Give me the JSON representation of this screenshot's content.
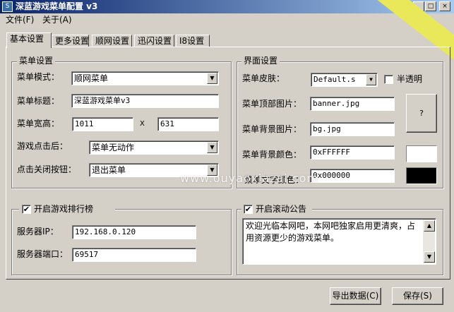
{
  "window": {
    "title": "深蓝游戏菜单配置 v3",
    "icon_label": "S",
    "minimize_glyph": "_",
    "maximize_glyph": "□",
    "close_glyph": "×"
  },
  "menu": [
    "文件(F)",
    "关于(A)"
  ],
  "tabs": [
    {
      "label": "基本设置",
      "active": true
    },
    {
      "label": "更多设置",
      "active": false
    },
    {
      "label": "顺网设置",
      "active": false
    },
    {
      "label": "迅闪设置",
      "active": false
    },
    {
      "label": "I8设置",
      "active": false
    }
  ],
  "menu_settings": {
    "group_title": "菜单设置",
    "mode_label": "菜单模式：",
    "mode_value": "顺网菜单",
    "title_label": "菜单标题：",
    "title_value": "深蓝游戏菜单v3",
    "size_label": "菜单宽高：",
    "width_value": "1011",
    "x_sep": "X",
    "height_value": "631",
    "after_click_label": "游戏点击后：",
    "after_click_value": "菜单无动作",
    "close_button_label": "点击关闭按钮：",
    "close_button_value": "退出菜单"
  },
  "ui_settings": {
    "group_title": "界面设置",
    "skin_label": "菜单皮肤：",
    "skin_value": "Default.s",
    "translucent_label": "半透明",
    "translucent_checked": false,
    "banner_label": "菜单顶部图片：",
    "banner_value": "banner.jpg",
    "bg_label": "菜单背景图片：",
    "bg_value": "bg.jpg",
    "bgcolor_label": "菜单背景颜色：",
    "bgcolor_value": "0xFFFFFF",
    "bgcolor_swatch": "#FFFFFF",
    "textcolor_label": "菜单文字颜色：",
    "textcolor_value": "0x000000",
    "textcolor_swatch": "#000000",
    "help_button": "?"
  },
  "ranking": {
    "checkbox_label": "开启游戏排行榜",
    "checked": true,
    "server_ip_label": "服务器IP：",
    "server_ip_value": "192.168.0.120",
    "server_port_label": "服务器端口：",
    "server_port_value": "69517"
  },
  "notice": {
    "checkbox_label": "开启滚动公告",
    "checked": true,
    "text": "欢迎光临本网吧，本网吧独家启用更清爽，占用资源更少的游戏菜单。"
  },
  "buttons": {
    "export": "导出数据(C)",
    "save": "保存(S)"
  },
  "check_glyph": "✔",
  "arrow_down": "▼",
  "arrow_up": "▲",
  "watermark": "www.ouyaoxiazai.com"
}
